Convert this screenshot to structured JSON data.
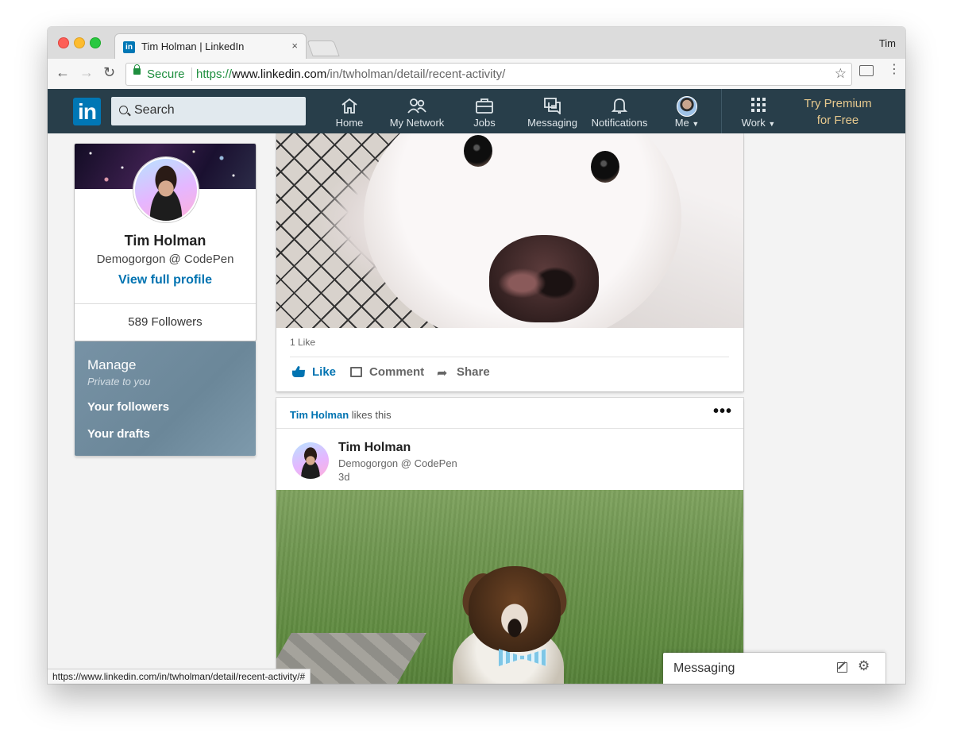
{
  "browser": {
    "tab_title": "Tim Holman | LinkedIn",
    "tab_favicon": "in",
    "tab_close": "×",
    "profile_name": "Tim",
    "secure_label": "Secure",
    "url_scheme": "https://",
    "url_host": "www.linkedin.com",
    "url_path": "/in/twholman/detail/recent-activity/",
    "status_url": "https://www.linkedin.com/in/twholman/detail/recent-activity/#"
  },
  "linkedin_nav": {
    "logo": "in",
    "search_placeholder": "Search",
    "items": [
      {
        "label": "Home",
        "icon": "home-icon"
      },
      {
        "label": "My Network",
        "icon": "network-icon"
      },
      {
        "label": "Jobs",
        "icon": "briefcase-icon"
      },
      {
        "label": "Messaging",
        "icon": "messaging-icon"
      },
      {
        "label": "Notifications",
        "icon": "bell-icon"
      },
      {
        "label": "Me",
        "icon": "avatar"
      },
      {
        "label": "Work",
        "icon": "grid-icon"
      }
    ],
    "premium_line1": "Try Premium",
    "premium_line2": "for Free"
  },
  "profile_card": {
    "name": "Tim Holman",
    "headline": "Demogorgon @ CodePen",
    "view_profile": "View full profile",
    "followers": "589 Followers"
  },
  "manage": {
    "title": "Manage",
    "subtitle": "Private to you",
    "items": [
      "Your followers",
      "Your drafts"
    ]
  },
  "post1": {
    "likes": "1 Like",
    "actions": {
      "like": "Like",
      "comment": "Comment",
      "share": "Share"
    }
  },
  "post2": {
    "liker": "Tim Holman",
    "liker_suffix": "likes this",
    "author": "Tim Holman",
    "headline": "Demogorgon @ CodePen",
    "time": "3d",
    "menu": "•••"
  },
  "messaging": {
    "title": "Messaging"
  },
  "colors": {
    "linkedin_blue": "#0077b5",
    "nav_bg": "#283e4a",
    "premium_gold": "#e7c98e",
    "link_blue": "#0073b1",
    "secure_green": "#1e8e3e"
  }
}
